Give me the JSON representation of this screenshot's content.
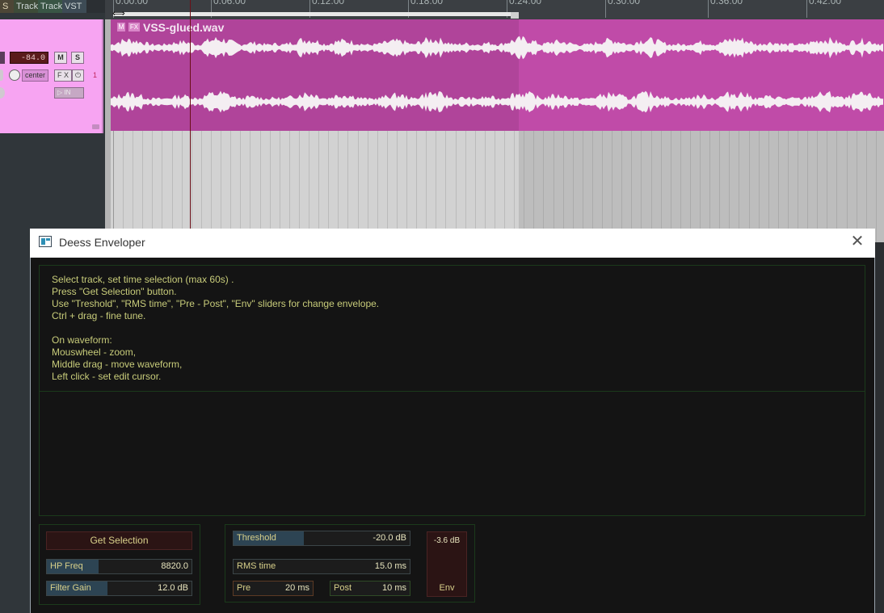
{
  "reaper": {
    "tabs": [
      "S",
      "Track",
      "Track",
      "VST"
    ],
    "track": {
      "volume": "-84.0",
      "mute_label": "M",
      "solo_label": "S",
      "pan": "center",
      "fx_label": "F X",
      "power_label": "⏻",
      "in_label": "IN",
      "number": "1"
    },
    "timeline": {
      "ticks": [
        "0:00.00",
        "0:06.00",
        "0:12.00",
        "0:18.00",
        "0:24.00",
        "0:30.00",
        "0:36.00",
        "0:42.00"
      ]
    },
    "item": {
      "m_label": "M",
      "fx_label": "FX",
      "name": "VSS-glued.wav"
    }
  },
  "dialog": {
    "title": "Deess Enveloper",
    "close_label": "✕",
    "instructions": "Select track, set time selection (max 60s) .\nPress \"Get Selection\" button.\nUse \"Treshold\", \"RMS time\", \"Pre - Post\", \"Env\" sliders for change envelope.\nCtrl + drag - fine tune.\n\nOn waveform:\nMouswheel - zoom,\nMiddle drag - move waveform,\nLeft click - set edit cursor.",
    "get_selection_label": "Get Selection",
    "hp_freq": {
      "label": "HP Freq",
      "value": "8820.0",
      "fill": 0.36
    },
    "filter_gain": {
      "label": "Filter Gain",
      "value": "12.0 dB",
      "fill": 0.42
    },
    "threshold": {
      "label": "Threshold",
      "value": "-20.0 dB",
      "fill": 0.4
    },
    "rms_time": {
      "label": "RMS time",
      "value": "15.0 ms",
      "fill": 0.0
    },
    "pre": {
      "label": "Pre",
      "value": "20 ms"
    },
    "post": {
      "label": "Post",
      "value": "10 ms"
    },
    "env": {
      "value": "-3.6 dB",
      "label": "Env"
    }
  }
}
